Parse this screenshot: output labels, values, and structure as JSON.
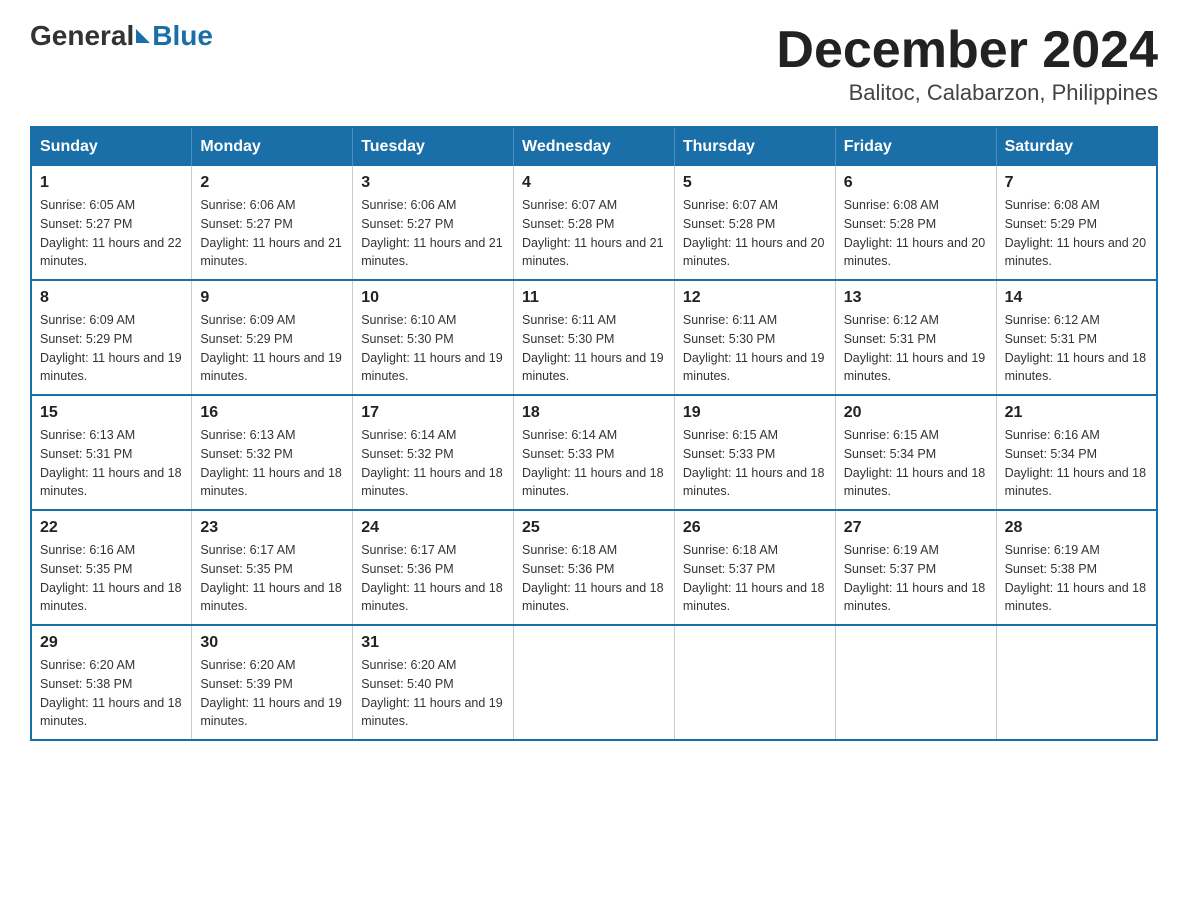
{
  "header": {
    "logo_general": "General",
    "logo_blue": "Blue",
    "month_title": "December 2024",
    "subtitle": "Balitoc, Calabarzon, Philippines"
  },
  "days_of_week": [
    "Sunday",
    "Monday",
    "Tuesday",
    "Wednesday",
    "Thursday",
    "Friday",
    "Saturday"
  ],
  "weeks": [
    [
      {
        "day": "1",
        "sunrise": "6:05 AM",
        "sunset": "5:27 PM",
        "daylight": "11 hours and 22 minutes."
      },
      {
        "day": "2",
        "sunrise": "6:06 AM",
        "sunset": "5:27 PM",
        "daylight": "11 hours and 21 minutes."
      },
      {
        "day": "3",
        "sunrise": "6:06 AM",
        "sunset": "5:27 PM",
        "daylight": "11 hours and 21 minutes."
      },
      {
        "day": "4",
        "sunrise": "6:07 AM",
        "sunset": "5:28 PM",
        "daylight": "11 hours and 21 minutes."
      },
      {
        "day": "5",
        "sunrise": "6:07 AM",
        "sunset": "5:28 PM",
        "daylight": "11 hours and 20 minutes."
      },
      {
        "day": "6",
        "sunrise": "6:08 AM",
        "sunset": "5:28 PM",
        "daylight": "11 hours and 20 minutes."
      },
      {
        "day": "7",
        "sunrise": "6:08 AM",
        "sunset": "5:29 PM",
        "daylight": "11 hours and 20 minutes."
      }
    ],
    [
      {
        "day": "8",
        "sunrise": "6:09 AM",
        "sunset": "5:29 PM",
        "daylight": "11 hours and 19 minutes."
      },
      {
        "day": "9",
        "sunrise": "6:09 AM",
        "sunset": "5:29 PM",
        "daylight": "11 hours and 19 minutes."
      },
      {
        "day": "10",
        "sunrise": "6:10 AM",
        "sunset": "5:30 PM",
        "daylight": "11 hours and 19 minutes."
      },
      {
        "day": "11",
        "sunrise": "6:11 AM",
        "sunset": "5:30 PM",
        "daylight": "11 hours and 19 minutes."
      },
      {
        "day": "12",
        "sunrise": "6:11 AM",
        "sunset": "5:30 PM",
        "daylight": "11 hours and 19 minutes."
      },
      {
        "day": "13",
        "sunrise": "6:12 AM",
        "sunset": "5:31 PM",
        "daylight": "11 hours and 19 minutes."
      },
      {
        "day": "14",
        "sunrise": "6:12 AM",
        "sunset": "5:31 PM",
        "daylight": "11 hours and 18 minutes."
      }
    ],
    [
      {
        "day": "15",
        "sunrise": "6:13 AM",
        "sunset": "5:31 PM",
        "daylight": "11 hours and 18 minutes."
      },
      {
        "day": "16",
        "sunrise": "6:13 AM",
        "sunset": "5:32 PM",
        "daylight": "11 hours and 18 minutes."
      },
      {
        "day": "17",
        "sunrise": "6:14 AM",
        "sunset": "5:32 PM",
        "daylight": "11 hours and 18 minutes."
      },
      {
        "day": "18",
        "sunrise": "6:14 AM",
        "sunset": "5:33 PM",
        "daylight": "11 hours and 18 minutes."
      },
      {
        "day": "19",
        "sunrise": "6:15 AM",
        "sunset": "5:33 PM",
        "daylight": "11 hours and 18 minutes."
      },
      {
        "day": "20",
        "sunrise": "6:15 AM",
        "sunset": "5:34 PM",
        "daylight": "11 hours and 18 minutes."
      },
      {
        "day": "21",
        "sunrise": "6:16 AM",
        "sunset": "5:34 PM",
        "daylight": "11 hours and 18 minutes."
      }
    ],
    [
      {
        "day": "22",
        "sunrise": "6:16 AM",
        "sunset": "5:35 PM",
        "daylight": "11 hours and 18 minutes."
      },
      {
        "day": "23",
        "sunrise": "6:17 AM",
        "sunset": "5:35 PM",
        "daylight": "11 hours and 18 minutes."
      },
      {
        "day": "24",
        "sunrise": "6:17 AM",
        "sunset": "5:36 PM",
        "daylight": "11 hours and 18 minutes."
      },
      {
        "day": "25",
        "sunrise": "6:18 AM",
        "sunset": "5:36 PM",
        "daylight": "11 hours and 18 minutes."
      },
      {
        "day": "26",
        "sunrise": "6:18 AM",
        "sunset": "5:37 PM",
        "daylight": "11 hours and 18 minutes."
      },
      {
        "day": "27",
        "sunrise": "6:19 AM",
        "sunset": "5:37 PM",
        "daylight": "11 hours and 18 minutes."
      },
      {
        "day": "28",
        "sunrise": "6:19 AM",
        "sunset": "5:38 PM",
        "daylight": "11 hours and 18 minutes."
      }
    ],
    [
      {
        "day": "29",
        "sunrise": "6:20 AM",
        "sunset": "5:38 PM",
        "daylight": "11 hours and 18 minutes."
      },
      {
        "day": "30",
        "sunrise": "6:20 AM",
        "sunset": "5:39 PM",
        "daylight": "11 hours and 19 minutes."
      },
      {
        "day": "31",
        "sunrise": "6:20 AM",
        "sunset": "5:40 PM",
        "daylight": "11 hours and 19 minutes."
      },
      null,
      null,
      null,
      null
    ]
  ]
}
